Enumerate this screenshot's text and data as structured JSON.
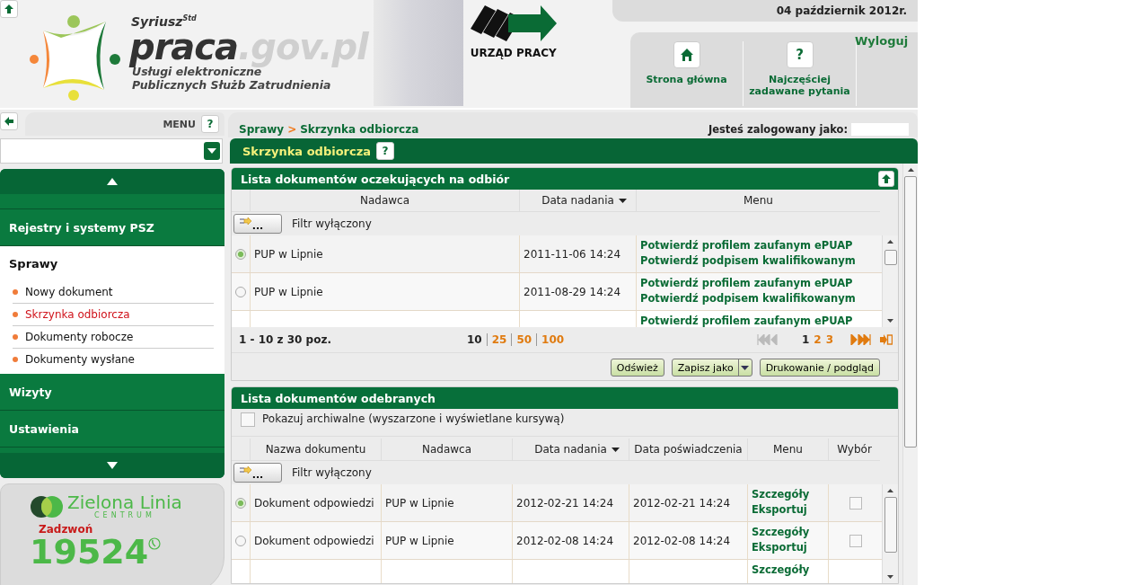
{
  "header": {
    "brand_super": "Syriusz",
    "brand_sup": "Std",
    "brand_main": "praca",
    "brand_domain": ".gov.pl",
    "tagline": [
      "Usługi elektroniczne",
      "Publicznych Służb Zatrudnienia"
    ],
    "office_logo": "URZĄD PRACY",
    "date": "04 październik 2012r.",
    "nav": [
      {
        "kind": "home",
        "label": "Strona główna"
      },
      {
        "kind": "help",
        "label": "Najczęściej zadawane pytania",
        "help_glyph": "?"
      }
    ],
    "logout": "Wyloguj"
  },
  "menu_bar": {
    "label": "MENU",
    "help": "?"
  },
  "breadcrumb": [
    {
      "label": "Sprawy"
    },
    {
      "label": "Skrzynka odbiorcza"
    }
  ],
  "breadcrumb_sep": ">",
  "logged_in": {
    "label": "Jesteś zalogowany jako:"
  },
  "page_title": {
    "label": "Skrzynka odbiorcza",
    "help": "?"
  },
  "sidebar": {
    "sections": [
      {
        "label": "Rejestry i systemy PSZ",
        "expanded": false
      },
      {
        "label": "Sprawy",
        "expanded": true,
        "items": [
          {
            "label": "Nowy dokument",
            "selected": false
          },
          {
            "label": "Skrzynka odbiorcza",
            "selected": true
          },
          {
            "label": "Dokumenty robocze",
            "selected": false
          },
          {
            "label": "Dokumenty wysłane",
            "selected": false
          }
        ]
      },
      {
        "label": "Wizyty",
        "expanded": false
      },
      {
        "label": "Ustawienia",
        "expanded": false
      }
    ]
  },
  "promo": {
    "name": "Zielona Linia",
    "sub": "CENTRUM",
    "call": "Zadzwoń",
    "number": "19524"
  },
  "pending": {
    "title": "Lista dokumentów oczekujących na odbiór",
    "columns": [
      "Nadawca",
      "Data nadania",
      "Menu"
    ],
    "filter_button": "...",
    "filter_label": "Filtr wyłączony",
    "rows": [
      {
        "selected": true,
        "sender": "PUP w Lipnie",
        "date": "2011-11-06 14:24",
        "links": [
          "Potwierdź profilem zaufanym ePUAP",
          "Potwierdź podpisem kwalifikowanym"
        ]
      },
      {
        "selected": false,
        "sender": "PUP w Lipnie",
        "date": "2011-08-29 14:24",
        "links": [
          "Potwierdź profilem zaufanym ePUAP",
          "Potwierdź podpisem kwalifikowanym"
        ]
      },
      {
        "links": [
          "Potwierdź profilem zaufanym ePUAP"
        ]
      }
    ],
    "range": "1 - 10 z 30 poz.",
    "page_sizes": [
      {
        "label": "10",
        "selected": true
      },
      {
        "label": "25",
        "selected": false
      },
      {
        "label": "50",
        "selected": false
      },
      {
        "label": "100",
        "selected": false
      }
    ],
    "pages": [
      {
        "label": "1",
        "selected": true
      },
      {
        "label": "2",
        "selected": false
      },
      {
        "label": "3",
        "selected": false
      }
    ],
    "buttons": [
      {
        "kind": "plain",
        "label": "Odśwież"
      },
      {
        "kind": "split",
        "label": "Zapisz jako"
      },
      {
        "kind": "plain",
        "label": "Drukowanie / podgląd"
      }
    ]
  },
  "received": {
    "title": "Lista dokumentów odebranych",
    "archive": {
      "label": "Pokazuj archiwalne (wyszarzone i wyświetlane kursywą)",
      "checked": false
    },
    "columns": [
      "Nazwa dokumentu",
      "Nadawca",
      "Data nadania",
      "Data poświadczenia",
      "Menu",
      "Wybór"
    ],
    "filter_button": "...",
    "filter_label": "Filtr wyłączony",
    "rows": [
      {
        "selected": true,
        "name": "Dokument odpowiedzi",
        "sender": "PUP w Lipnie",
        "date": "2012-02-21 14:24",
        "confirmed": "2012-02-21 14:24",
        "links": [
          "Szczegóły",
          "Eksportuj"
        ],
        "checked": false
      },
      {
        "selected": false,
        "name": "Dokument odpowiedzi",
        "sender": "PUP w Lipnie",
        "date": "2012-02-08 14:24",
        "confirmed": "2012-02-08 14:24",
        "links": [
          "Szczegóły",
          "Eksportuj"
        ],
        "checked": false
      },
      {
        "links": [
          "Szczegóły"
        ]
      }
    ]
  }
}
